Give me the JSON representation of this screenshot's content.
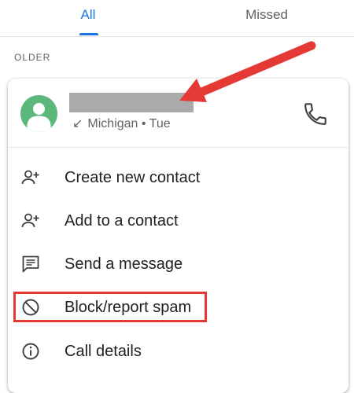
{
  "tabs": [
    {
      "label": "All",
      "selected": true
    },
    {
      "label": "Missed",
      "selected": false
    }
  ],
  "section_header": "OLDER",
  "call": {
    "location": "Michigan",
    "separator": "•",
    "day": "Tue",
    "direction_icon": "call-received-icon",
    "name_redacted": true
  },
  "menu": {
    "items": [
      {
        "label": "Create new contact",
        "icon": "person-add-icon"
      },
      {
        "label": "Add to a contact",
        "icon": "person-add-icon"
      },
      {
        "label": "Send a message",
        "icon": "message-icon"
      },
      {
        "label": "Block/report spam",
        "icon": "block-icon",
        "highlighted": true
      },
      {
        "label": "Call details",
        "icon": "info-icon"
      }
    ]
  },
  "colors": {
    "accent": "#1a73e8",
    "avatar": "#5cb87a",
    "annotation_red": "#e53935",
    "redaction_gray": "#aaaaaa"
  }
}
